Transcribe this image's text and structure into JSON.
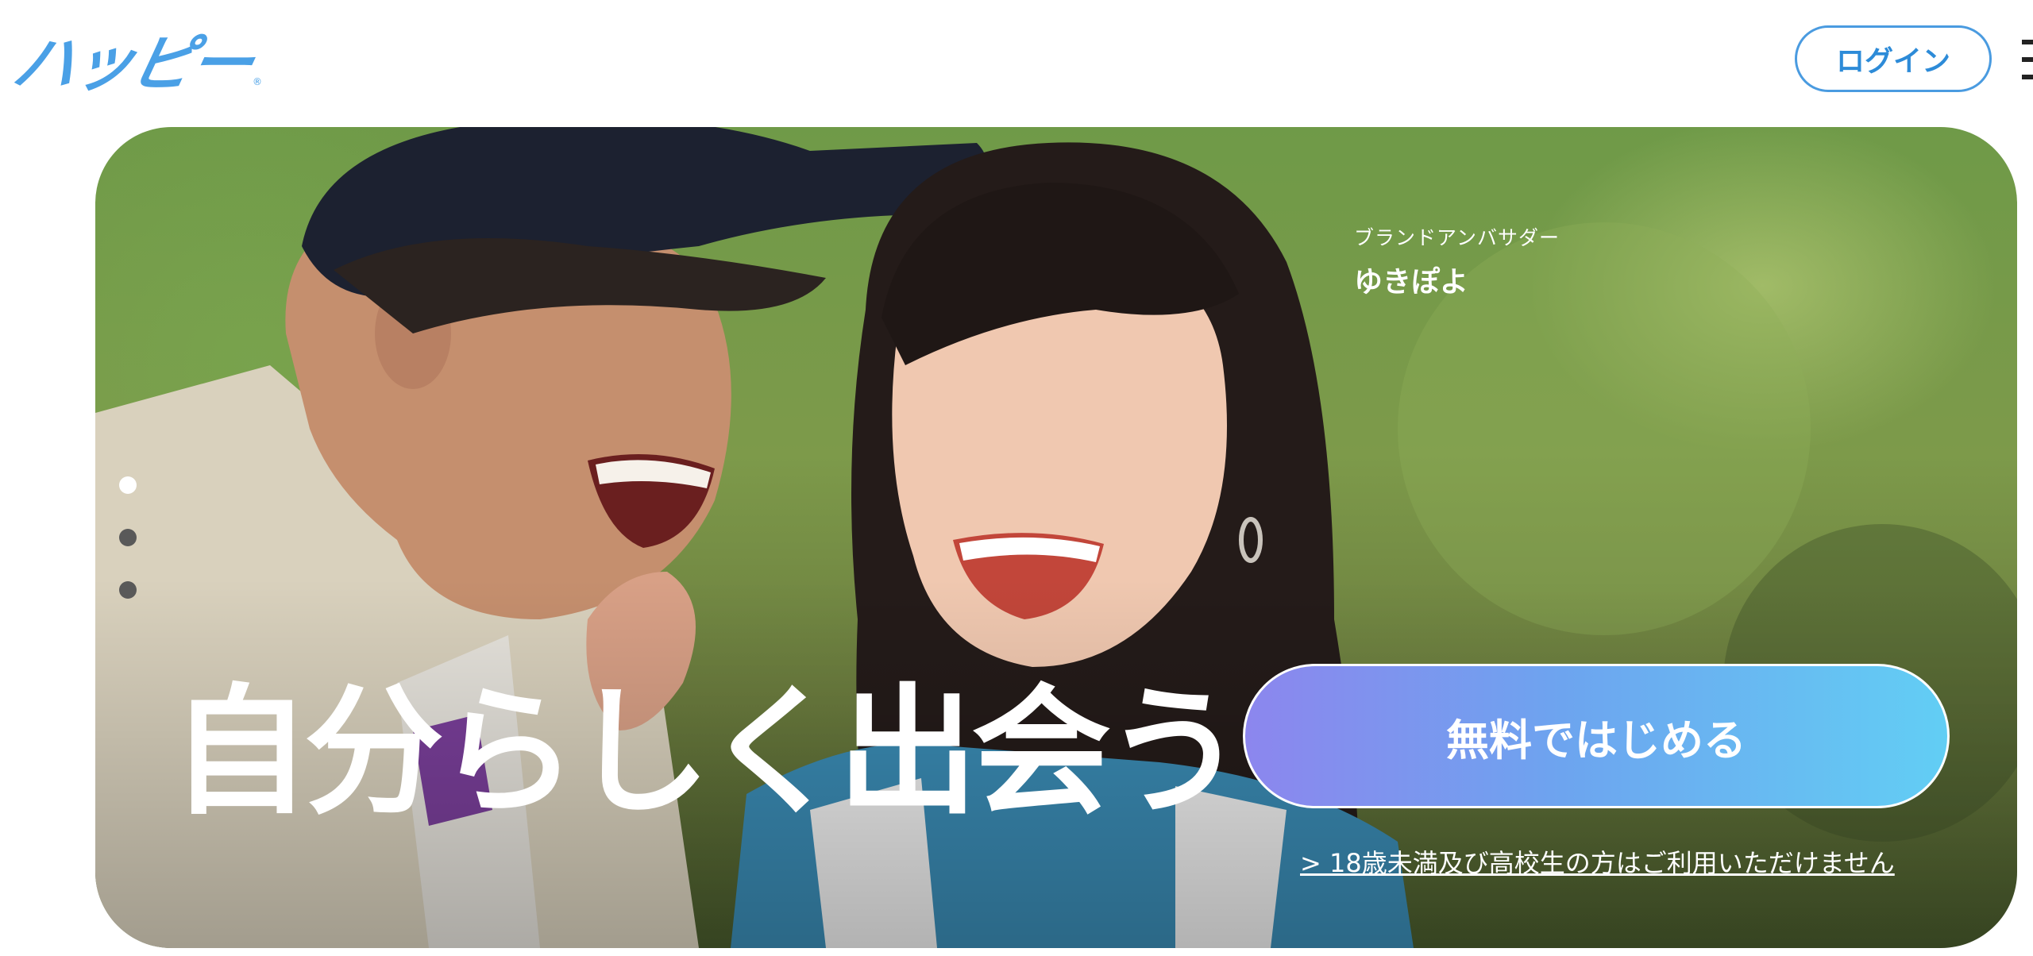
{
  "header": {
    "logo_text": "ハッピー",
    "logo_mark": "®",
    "login_label": "ログイン",
    "menu_icon": "hamburger-menu-icon"
  },
  "hero": {
    "ambassador_role": "ブランドアンバサダー",
    "ambassador_name": "ゆきぽよ",
    "headline": "自分らしく出会う",
    "cta_label": "無料ではじめる",
    "age_notice": "> 18歳未満及び高校生の方はご利用いただけません",
    "slides": {
      "count": 3,
      "active_index": 0
    }
  },
  "colors": {
    "brand_blue": "#4aa0e6",
    "login_border": "#4a9be0",
    "cta_gradient_start": "#8c86ee",
    "cta_gradient_end": "#62cef4",
    "dot_active": "#ffffff",
    "dot_inactive": "#595959"
  }
}
